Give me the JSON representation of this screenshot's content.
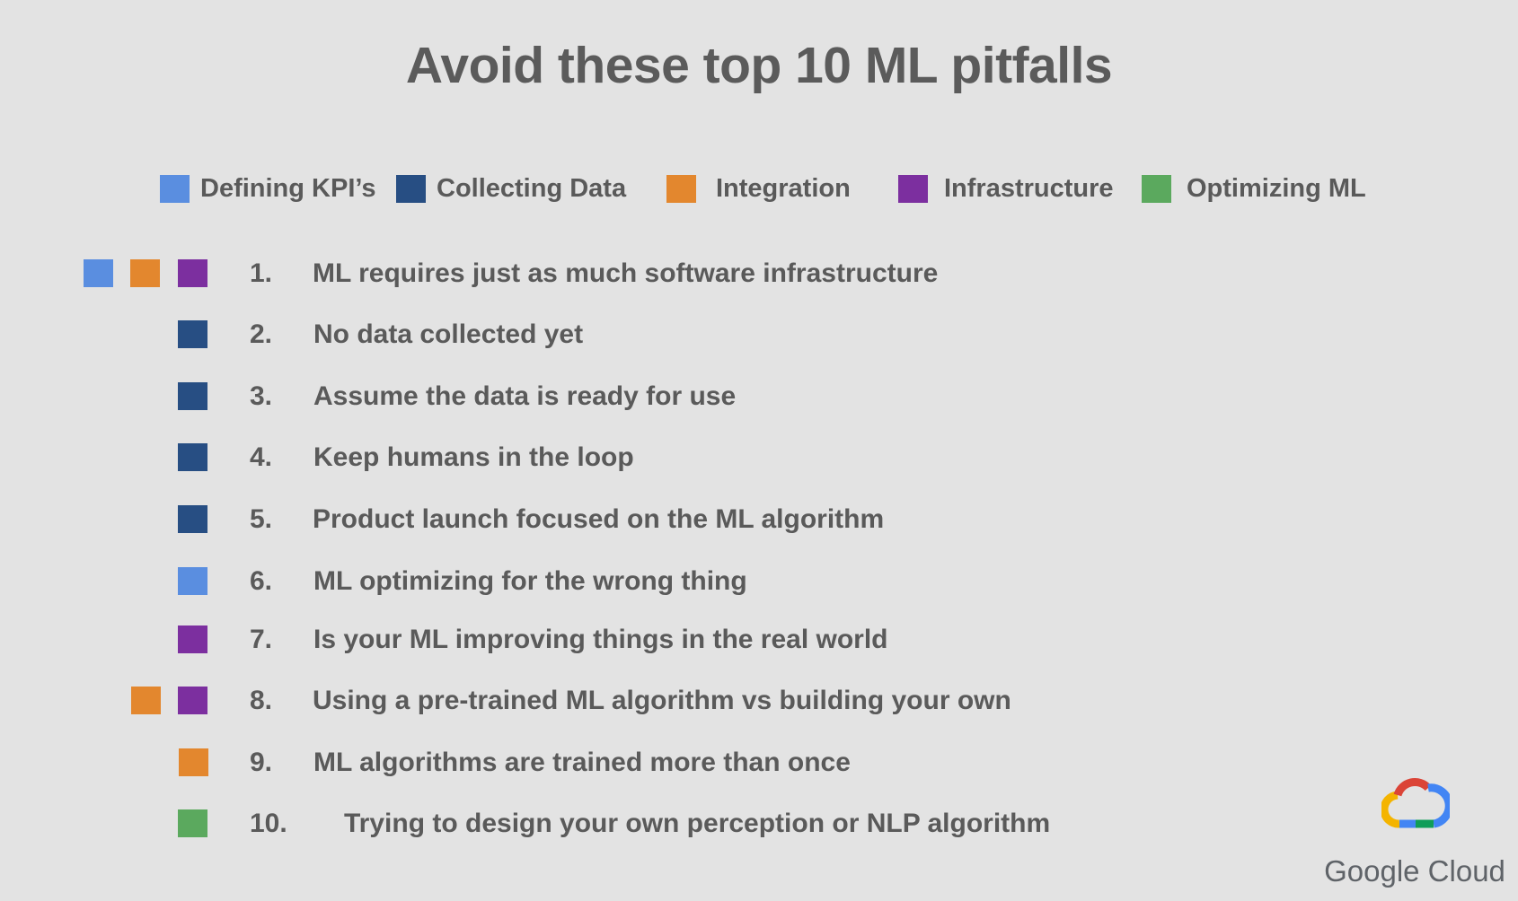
{
  "title": "Avoid these top 10 ML pitfalls",
  "colors": {
    "defining_kpis": "#5a8ee0",
    "collecting_data": "#274e83",
    "integration": "#e3872e",
    "infrastructure": "#7c2f9f",
    "optimizing_ml": "#5ba95e"
  },
  "legend": [
    {
      "label": "Defining KPI’s",
      "category": "defining_kpis"
    },
    {
      "label": "Collecting Data",
      "category": "collecting_data"
    },
    {
      "label": "Integration",
      "category": "integration"
    },
    {
      "label": "Infrastructure",
      "category": "infrastructure"
    },
    {
      "label": "Optimizing ML",
      "category": "optimizing_ml"
    }
  ],
  "pitfalls": [
    {
      "number": "1.",
      "text": "ML requires just as much software infrastructure",
      "tags": [
        "defining_kpis",
        "integration",
        "infrastructure"
      ]
    },
    {
      "number": "2.",
      "text": "No data collected yet",
      "tags": [
        "collecting_data"
      ]
    },
    {
      "number": "3.",
      "text": "Assume the data is ready for use",
      "tags": [
        "collecting_data"
      ]
    },
    {
      "number": "4.",
      "text": "Keep humans in the loop",
      "tags": [
        "collecting_data"
      ]
    },
    {
      "number": "5.",
      "text": "Product launch focused on the ML algorithm",
      "tags": [
        "collecting_data"
      ]
    },
    {
      "number": "6.",
      "text": "ML optimizing for the wrong thing",
      "tags": [
        "defining_kpis"
      ]
    },
    {
      "number": "7.",
      "text": "Is your ML improving things in the real world",
      "tags": [
        "infrastructure"
      ]
    },
    {
      "number": "8.",
      "text": "Using a pre-trained ML algorithm vs building your own",
      "tags": [
        "integration",
        "infrastructure"
      ]
    },
    {
      "number": "9.",
      "text": "ML algorithms are trained more than once",
      "tags": [
        "integration"
      ]
    },
    {
      "number": "10.",
      "text": "Trying to design your own perception or NLP algorithm",
      "tags": [
        "optimizing_ml"
      ]
    }
  ],
  "logo": {
    "text": "Google Cloud",
    "icon": "google-cloud-logo-icon"
  }
}
